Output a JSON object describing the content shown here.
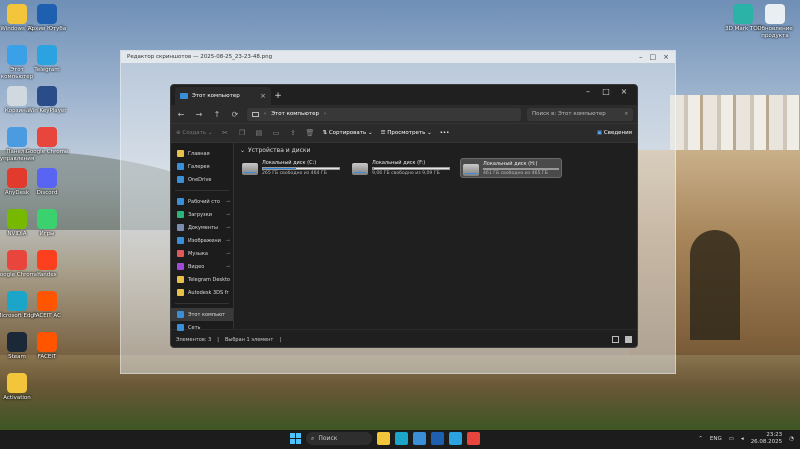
{
  "desktop": {
    "icons_left": [
      {
        "label": "Windows 11",
        "color": "#f3c53b"
      },
      {
        "label": "Этот компьютер",
        "color": "#3aa0e8"
      },
      {
        "label": "Корзина",
        "color": "#d0d8e0"
      },
      {
        "label": "Панель управления",
        "color": "#4b9be0"
      },
      {
        "label": "AnyDesk",
        "color": "#e23b2e"
      },
      {
        "label": "NVIDIA",
        "color": "#76b900"
      },
      {
        "label": "Google Chrome",
        "color": "#e8453c"
      },
      {
        "label": "Microsoft Edge",
        "color": "#1ba6c9"
      },
      {
        "label": "Steam",
        "color": "#1b2838"
      },
      {
        "label": "Activation",
        "color": "#f3c53b"
      }
    ],
    "icons_col2": [
      {
        "label": "Архив Ютуба",
        "color": "#1f5fb0"
      },
      {
        "label": "Telegram",
        "color": "#2aa3e0"
      },
      {
        "label": "Win KeyPlayer",
        "color": "#2a4d8a"
      },
      {
        "label": "Google Chrome",
        "color": "#e8453c"
      },
      {
        "label": "Discord",
        "color": "#5865f2"
      },
      {
        "label": "Игры",
        "color": "#3bd16f"
      },
      {
        "label": "Yandex",
        "color": "#fc3f1d"
      },
      {
        "label": "FACEIT AC",
        "color": "#ff5500"
      },
      {
        "label": "FACEIT",
        "color": "#ff5500"
      }
    ],
    "icons_right": [
      {
        "label": "3D Mark TOP",
        "color": "#2ab3a6"
      },
      {
        "label": "Обновление продукта",
        "color": "#e9eef3"
      }
    ]
  },
  "viewer": {
    "title": "Редактор скриншотов — 2025-08-25_23-23-48.png"
  },
  "explorer": {
    "tab_title": "Этот компьютер",
    "address": "Этот компьютер",
    "search_placeholder": "Поиск в: Этот компьютер",
    "toolbar": {
      "create": "Создать",
      "sort": "Сортировать",
      "view": "Просмотреть",
      "more": "•••",
      "details": "Сведения"
    },
    "nav": [
      {
        "label": "Главная",
        "color": "#e8c04a",
        "pinned": false
      },
      {
        "label": "Галерея",
        "color": "#3a8fd8",
        "pinned": false
      },
      {
        "label": "OneDrive",
        "color": "#3a8fd8",
        "pinned": false
      },
      {
        "label": "Рабочий сто",
        "color": "#3a8fd8",
        "pinned": true
      },
      {
        "label": "Загрузки",
        "color": "#2eb37a",
        "pinned": true
      },
      {
        "label": "Документы",
        "color": "#7a8fb0",
        "pinned": true
      },
      {
        "label": "Изображени",
        "color": "#3a8fd8",
        "pinned": true
      },
      {
        "label": "Музыка",
        "color": "#e05a5a",
        "pinned": true
      },
      {
        "label": "Видео",
        "color": "#a04ad8",
        "pinned": true
      },
      {
        "label": "Telegram Deskto",
        "color": "#e8c04a",
        "pinned": false
      },
      {
        "label": "Autodesk 3DS fr",
        "color": "#e8c04a",
        "pinned": false
      },
      {
        "label": "Этот компьют",
        "color": "#3a8fd8",
        "pinned": false
      },
      {
        "label": "Сеть",
        "color": "#3a8fd8",
        "pinned": false
      }
    ],
    "group_title": "Устройства и диски",
    "drives": [
      {
        "name": "Локальный диск (C:)",
        "free": "265 ГБ свободно из 464 ГБ",
        "used_fraction": 0.43
      },
      {
        "name": "Локальный диск (F:)",
        "free": "9,06 ГБ свободно из 9,09 ГБ",
        "used_fraction": 0.01
      },
      {
        "name": "Локальный диск (H:)",
        "free": "461 ГБ свободно из 465 ГБ",
        "used_fraction": 0.01
      }
    ],
    "status": {
      "count": "Элементов: 3",
      "selected": "Выбран 1 элемент"
    }
  },
  "taskbar": {
    "search": "Поиск",
    "lang": "ENG",
    "time": "23:23",
    "date": "26.08.2025",
    "pinned": [
      {
        "name": "Проводник",
        "color": "#f3c53b"
      },
      {
        "name": "Edge",
        "color": "#1ba6c9"
      },
      {
        "name": "Microsoft Store",
        "color": "#3a8fd8"
      },
      {
        "name": "Архив Ютуба",
        "color": "#1f5fb0"
      },
      {
        "name": "Telegram",
        "color": "#2aa3e0"
      },
      {
        "name": "Chrome",
        "color": "#e8453c"
      }
    ]
  }
}
